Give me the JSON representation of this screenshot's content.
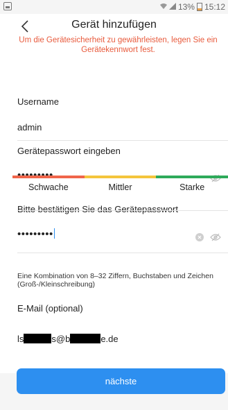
{
  "status_bar": {
    "battery": "13%",
    "time": "15:12"
  },
  "header": {
    "title": "Gerät hinzufügen",
    "notice": "Um die Gerätesicherheit zu gewährleisten, legen Sie ein Gerätekennwort fest."
  },
  "form": {
    "username_label": "Username",
    "username_value": "admin",
    "password_label": "Gerätepasswort eingeben",
    "password_value": "•••••••••",
    "strength": {
      "weak": "Schwache",
      "medium": "Mittler",
      "strong": "Starke",
      "colors": [
        "#f0654a",
        "#f4c53c",
        "#2eaa5a"
      ]
    },
    "confirm_label": "Bitte bestätigen Sie das Gerätepasswort",
    "confirm_value": "•••••••••",
    "hint": "Eine Kombination von 8–32 Ziffern, Buchstaben und Zeichen (Groß-/Kleinschreibung)",
    "email_label": "E-Mail (optional)",
    "email_parts": [
      "ls",
      "s@b",
      "e.de"
    ]
  },
  "buttons": {
    "next": "nächste"
  },
  "colors": {
    "accent": "#2d8ff0",
    "notice": "#e85a3c"
  }
}
